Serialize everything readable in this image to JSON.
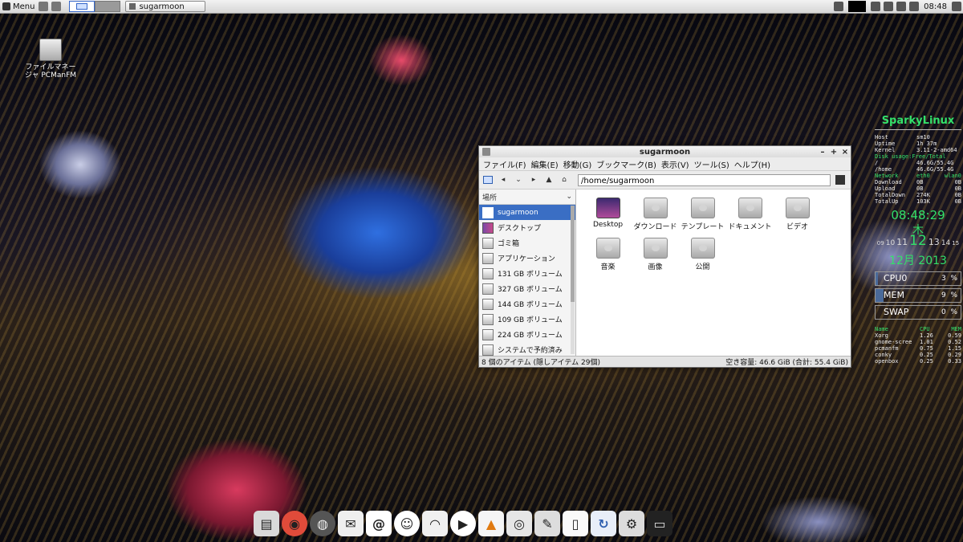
{
  "panel": {
    "menu_label": "Menu",
    "task_title": "sugarmoon",
    "clock": "08:48"
  },
  "desktop_icon": {
    "label": "ファイルマネージャ PCManFM"
  },
  "window": {
    "title": "sugarmoon",
    "menu": [
      "ファイル(F)",
      "編集(E)",
      "移動(G)",
      "ブックマーク(B)",
      "表示(V)",
      "ツール(S)",
      "ヘルプ(H)"
    ],
    "path": "/home/sugarmoon",
    "places_label": "場所",
    "sidebar": [
      {
        "label": "sugarmoon",
        "icon": "home-icon"
      },
      {
        "label": "デスクトップ",
        "icon": "desktop-icon"
      },
      {
        "label": "ゴミ箱",
        "icon": "trash-icon"
      },
      {
        "label": "アプリケーション",
        "icon": "applications-icon"
      },
      {
        "label": "131 GB ボリューム",
        "icon": "drive-icon"
      },
      {
        "label": "327 GB ボリューム",
        "icon": "drive-icon"
      },
      {
        "label": "144 GB ボリューム",
        "icon": "drive-icon"
      },
      {
        "label": "109 GB ボリューム",
        "icon": "drive-icon"
      },
      {
        "label": "224 GB ボリューム",
        "icon": "drive-icon"
      },
      {
        "label": "システムで予約済み",
        "icon": "drive-icon"
      }
    ],
    "files": [
      "Desktop",
      "ダウンロード",
      "テンプレート",
      "ドキュメント",
      "ビデオ",
      "音楽",
      "画像",
      "公開"
    ],
    "status_left": "8 個のアイテム (隠しアイテム 29個)",
    "status_right": "空き容量: 46.6 GiB (合計: 55.4 GiB)"
  },
  "conky": {
    "title": "SparkyLinux",
    "host": {
      "label": "Host",
      "value": "sm10"
    },
    "uptime": {
      "label": "Uptime",
      "value": "1h 37m"
    },
    "kernel": {
      "label": "Kernel",
      "value": "3.11-2-amd64"
    },
    "disk_header": "Disk usage:Free/Total",
    "disk_root": {
      "label": "/",
      "value": "46.6G/55.4G"
    },
    "disk_home": {
      "label": "/home",
      "value": "46.6G/55.4G"
    },
    "net_header": {
      "label": "Network",
      "c1": "eth0",
      "c2": "wlan0"
    },
    "net_rows": [
      {
        "label": "Download",
        "c1": "0B",
        "c2": "0B"
      },
      {
        "label": "Upload",
        "c1": "0B",
        "c2": "0B"
      },
      {
        "label": "TotalDown",
        "c1": "274K",
        "c2": "0B"
      },
      {
        "label": "TotalUp",
        "c1": "103K",
        "c2": "0B"
      }
    ],
    "time": "08:48:29",
    "weekday": "木",
    "days": [
      "09",
      "10",
      "11",
      "12",
      "13",
      "14",
      "15"
    ],
    "month": "12月 2013",
    "cpu": {
      "label": "CPU0",
      "value": "3",
      "unit": "%"
    },
    "mem": {
      "label": "MEM",
      "value": "9",
      "unit": "%"
    },
    "swap": {
      "label": "SWAP",
      "value": "0",
      "unit": "%"
    },
    "proc_header": {
      "name": "Name",
      "cpu": "CPU",
      "mem": "MEM"
    },
    "procs": [
      {
        "name": "Xorg",
        "cpu": "1.26",
        "mem": "0.59"
      },
      {
        "name": "gnome-scree",
        "cpu": "1.01",
        "mem": "0.52"
      },
      {
        "name": "pcmanfm",
        "cpu": "0.75",
        "mem": "1.15"
      },
      {
        "name": "conky",
        "cpu": "0.25",
        "mem": "0.29"
      },
      {
        "name": "openbox",
        "cpu": "0.25",
        "mem": "0.33"
      }
    ]
  },
  "dock": [
    {
      "icon": "file-manager-icon",
      "color": "#d9d9d9"
    },
    {
      "icon": "chrome-icon",
      "color": "#e04b3a"
    },
    {
      "icon": "globe-icon",
      "color": "#555555"
    },
    {
      "icon": "mail-icon",
      "color": "#efefef"
    },
    {
      "icon": "at-sign-icon",
      "color": "#ffffff"
    },
    {
      "icon": "chat-icon",
      "color": "#ffffff"
    },
    {
      "icon": "rss-icon",
      "color": "#f0f0f0"
    },
    {
      "icon": "play-icon",
      "color": "#ffffff"
    },
    {
      "icon": "vlc-icon",
      "color": "#f5f5f5"
    },
    {
      "icon": "disc-icon",
      "color": "#e6e6e6"
    },
    {
      "icon": "gimp-icon",
      "color": "#dddddd"
    },
    {
      "icon": "document-icon",
      "color": "#fafafa"
    },
    {
      "icon": "install-icon",
      "color": "#e8eef8"
    },
    {
      "icon": "tools-icon",
      "color": "#dcdcdc"
    },
    {
      "icon": "monitor-icon",
      "color": "#cfcfcf"
    }
  ]
}
